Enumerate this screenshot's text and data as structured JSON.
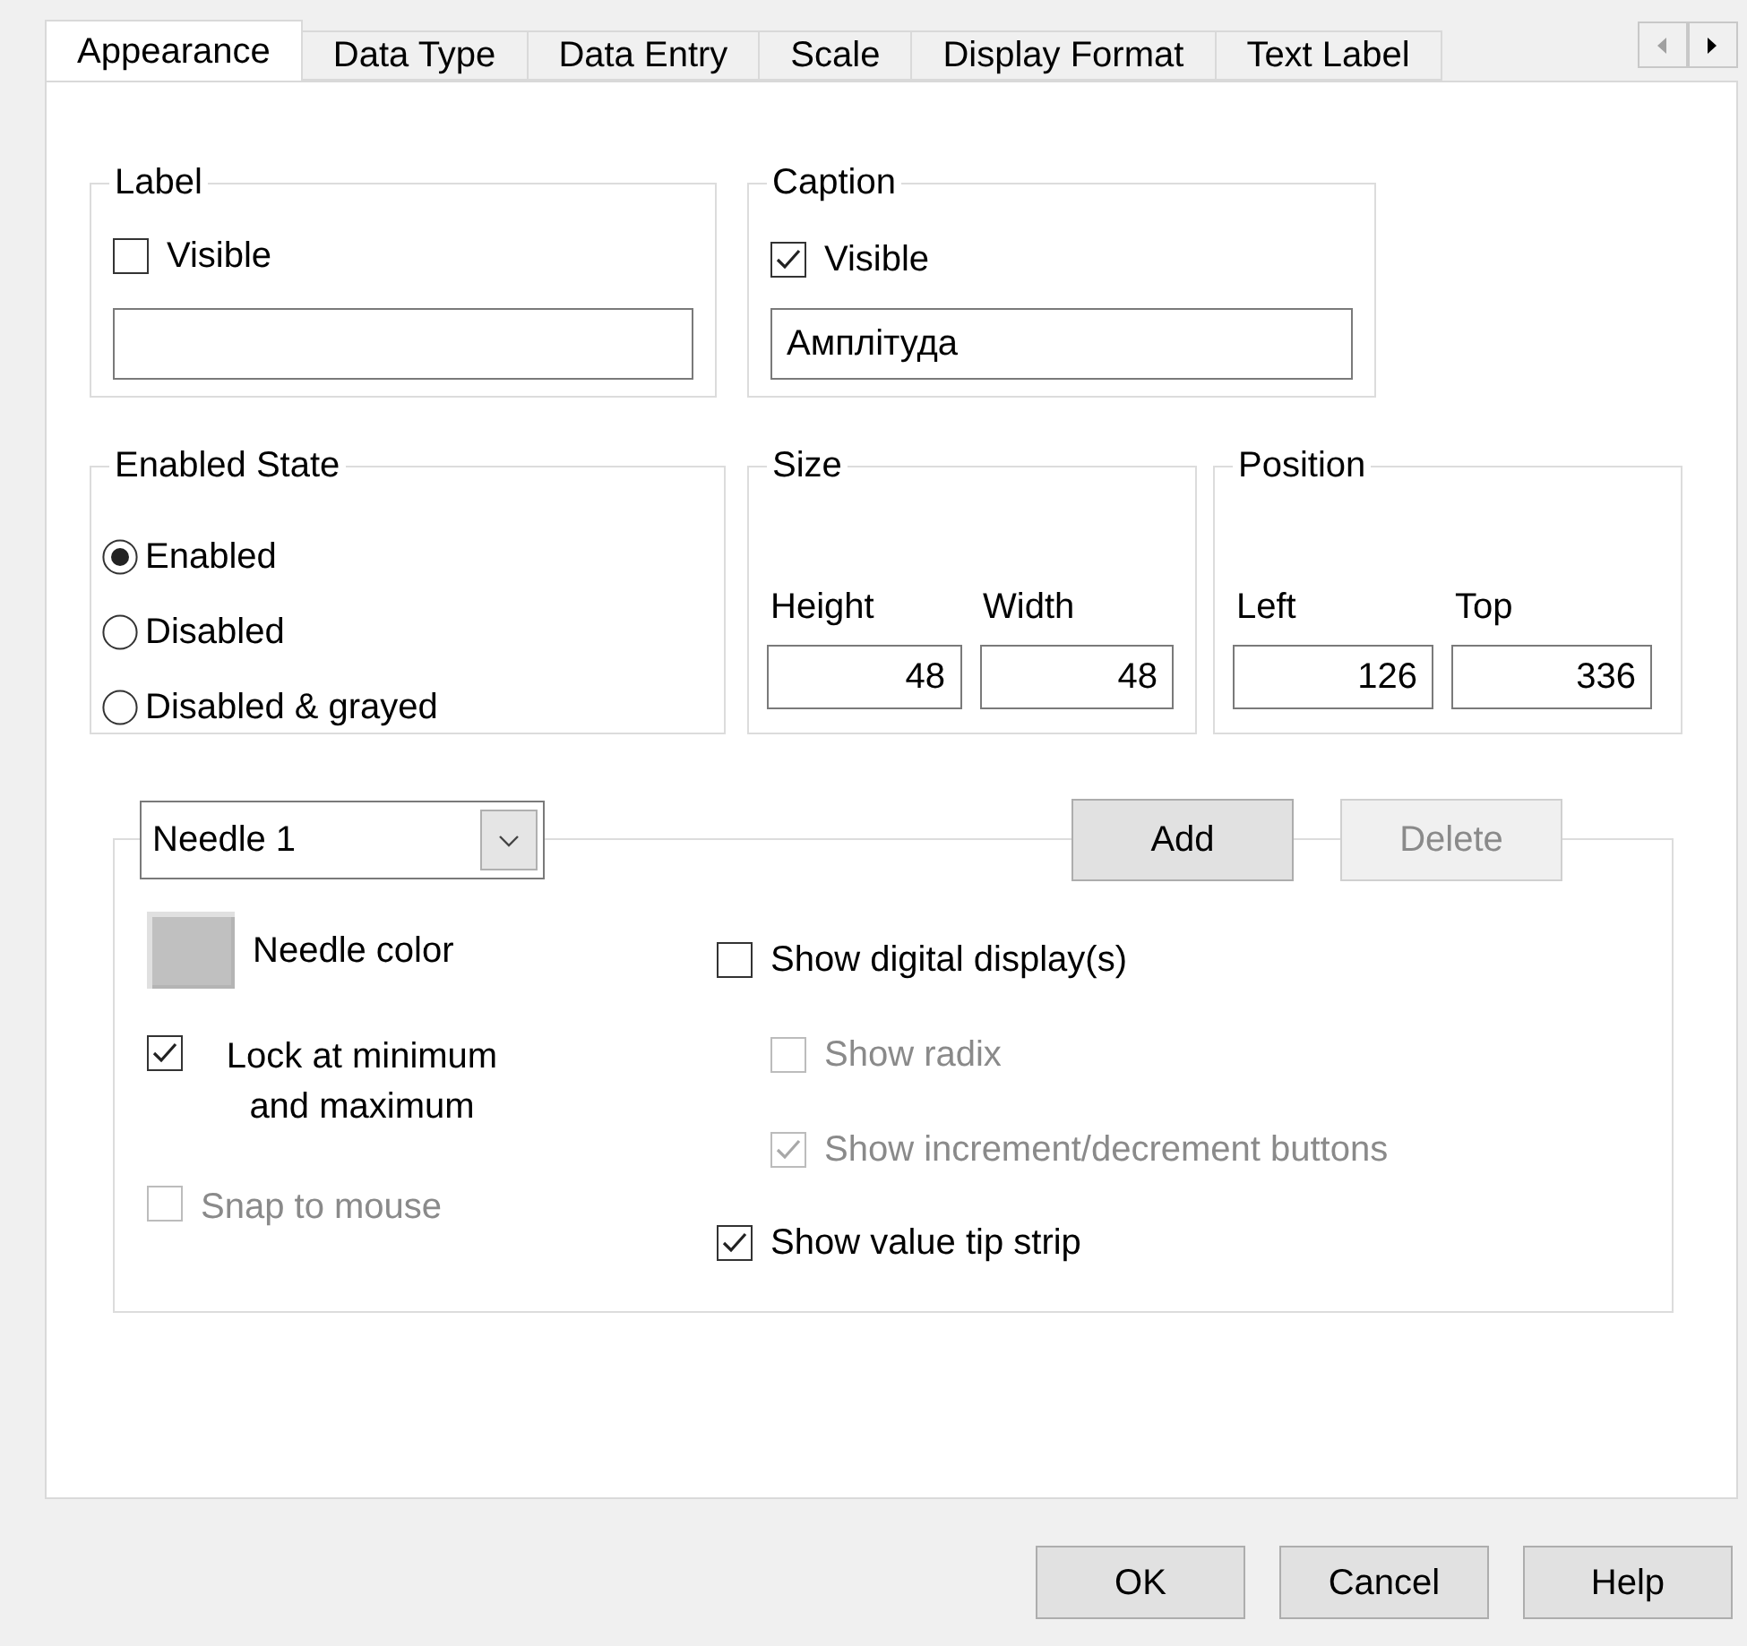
{
  "tabs": [
    {
      "label": "Appearance",
      "selected": true
    },
    {
      "label": "Data Type",
      "selected": false
    },
    {
      "label": "Data Entry",
      "selected": false
    },
    {
      "label": "Scale",
      "selected": false
    },
    {
      "label": "Display Format",
      "selected": false
    },
    {
      "label": "Text Label",
      "selected": false
    }
  ],
  "label_group": {
    "title": "Label",
    "visible": {
      "label": "Visible",
      "checked": false
    }
  },
  "caption_group": {
    "title": "Caption",
    "visible": {
      "label": "Visible",
      "checked": true
    },
    "value": "Амплітуда"
  },
  "enabled_state": {
    "title": "Enabled State",
    "options": [
      {
        "label": "Enabled",
        "selected": true
      },
      {
        "label": "Disabled",
        "selected": false
      },
      {
        "label": "Disabled & grayed",
        "selected": false
      }
    ]
  },
  "size": {
    "title": "Size",
    "fields": [
      {
        "label": "Height",
        "value": "48"
      },
      {
        "label": "Width",
        "value": "48"
      }
    ]
  },
  "position": {
    "title": "Position",
    "fields": [
      {
        "label": "Left",
        "value": "126"
      },
      {
        "label": "Top",
        "value": "336"
      }
    ]
  },
  "needle": {
    "dropdown": {
      "value": "Needle 1"
    },
    "add": {
      "label": "Add",
      "disabled": false
    },
    "delete": {
      "label": "Delete",
      "disabled": true
    },
    "color_label": "Needle color",
    "left_options": [
      {
        "label": "Lock at minimum and maximum",
        "checked": true,
        "disabled": false
      },
      {
        "label": "Snap to mouse",
        "checked": false,
        "disabled": true
      }
    ],
    "right_options": [
      {
        "label": "Show digital display(s)",
        "checked": false,
        "disabled": false,
        "children": [
          {
            "label": "Show radix",
            "checked": false,
            "disabled": true
          },
          {
            "label": "Show increment/decrement buttons",
            "checked": true,
            "disabled": true
          }
        ]
      },
      {
        "label": "Show value tip strip",
        "checked": true,
        "disabled": false
      }
    ]
  },
  "buttons": [
    {
      "label": "OK"
    },
    {
      "label": "Cancel"
    },
    {
      "label": "Help"
    }
  ]
}
